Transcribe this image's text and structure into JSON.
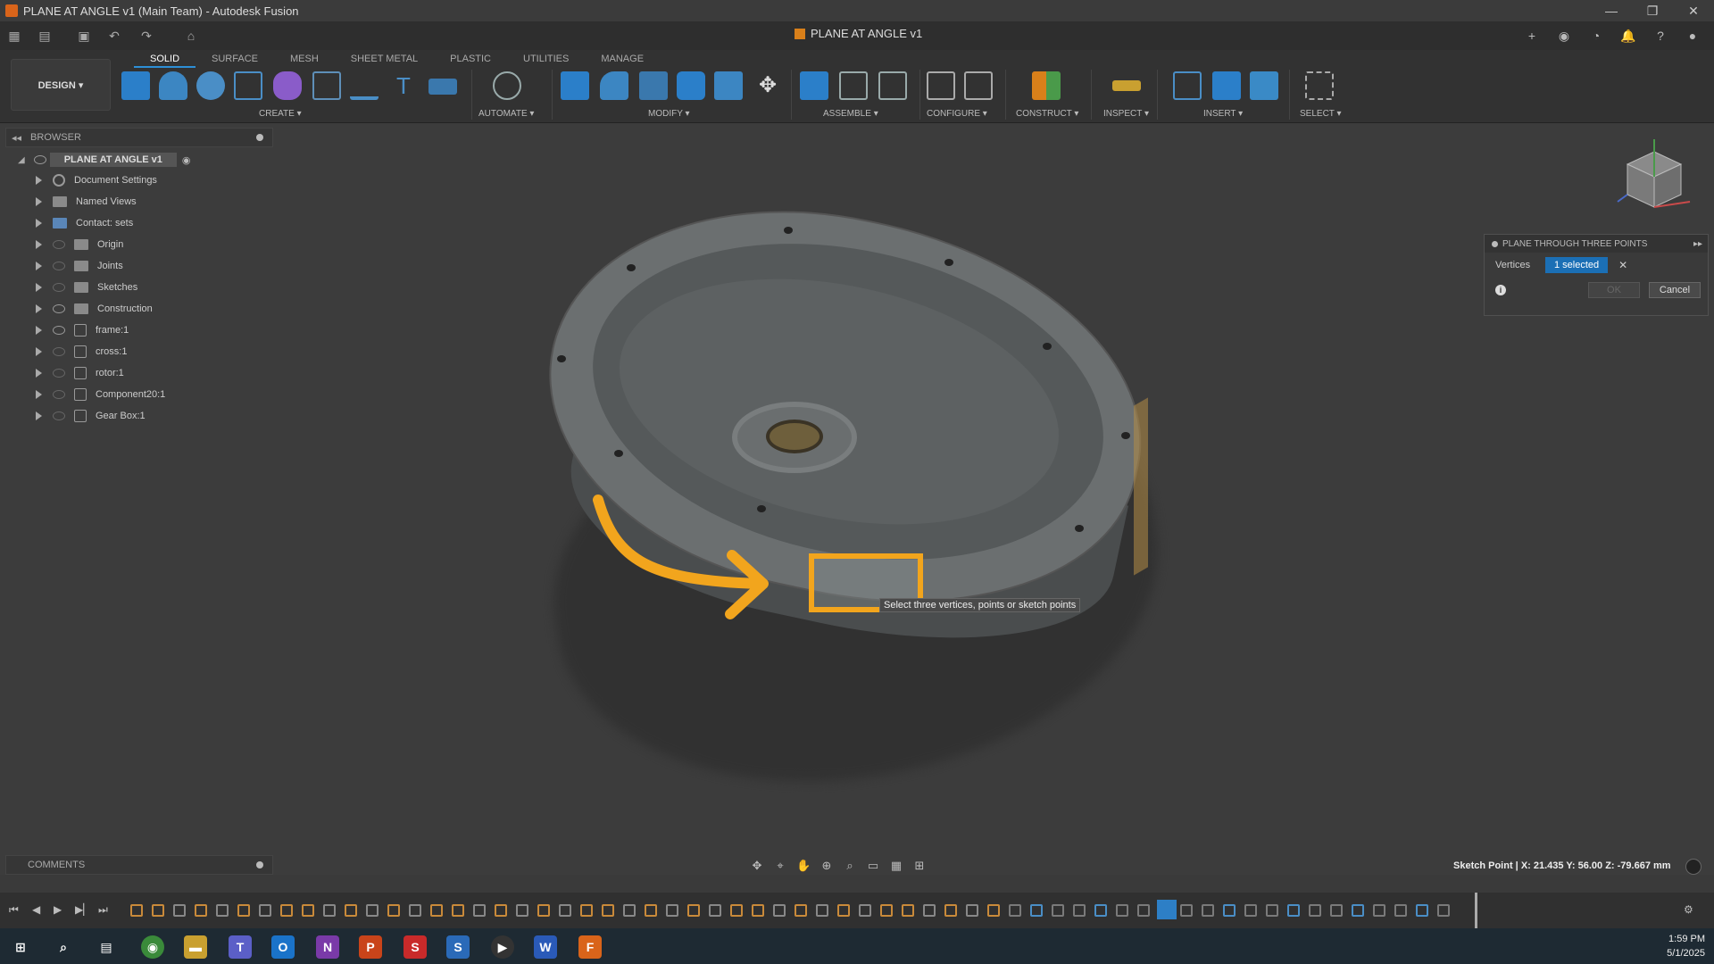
{
  "window": {
    "title": "PLANE AT ANGLE v1 (Main Team) - Autodesk Fusion",
    "controls": [
      "—",
      "❐",
      "✕"
    ]
  },
  "document_tab": {
    "title": "PLANE AT ANGLE v1"
  },
  "workspace": {
    "design_label": "DESIGN ▾"
  },
  "ribbon_tabs": [
    {
      "label": "SOLID",
      "active": true
    },
    {
      "label": "SURFACE"
    },
    {
      "label": "MESH"
    },
    {
      "label": "SHEET METAL"
    },
    {
      "label": "PLASTIC"
    },
    {
      "label": "UTILITIES"
    },
    {
      "label": "MANAGE"
    }
  ],
  "ribbon_groups": {
    "create": "CREATE ▾",
    "automate": "AUTOMATE ▾",
    "modify": "MODIFY ▾",
    "assemble": "ASSEMBLE ▾",
    "configure": "CONFIGURE ▾",
    "construct": "CONSTRUCT ▾",
    "inspect": "INSPECT ▾",
    "insert": "INSERT ▾",
    "select": "SELECT ▾"
  },
  "browser": {
    "header": "BROWSER",
    "root": "PLANE AT ANGLE v1",
    "items": [
      {
        "label": "Document Settings"
      },
      {
        "label": "Named Views"
      },
      {
        "label": "Contact: sets"
      },
      {
        "label": "Origin"
      },
      {
        "label": "Joints"
      },
      {
        "label": "Sketches"
      },
      {
        "label": "Construction"
      },
      {
        "label": "frame:1"
      },
      {
        "label": "cross:1"
      },
      {
        "label": "rotor:1"
      },
      {
        "label": "Component20:1"
      },
      {
        "label": "Gear Box:1"
      }
    ]
  },
  "command_dialog": {
    "title": "PLANE THROUGH THREE POINTS",
    "vertices_label": "Vertices",
    "selection": "1 selected",
    "ok_label": "OK",
    "cancel_label": "Cancel"
  },
  "tooltip": "Select three vertices, points or sketch points",
  "comments": {
    "header": "COMMENTS"
  },
  "status": {
    "coordinates": "Sketch Point | X: 21.435 Y: 56.00 Z: -79.667 mm"
  },
  "taskbar": {
    "time": "1:59 PM",
    "date": "5/1/2025"
  },
  "colors": {
    "accent": "#2d8fd6",
    "highlight": "#f2a51d",
    "selection": "#1b6fb5",
    "fusion": "#d9641a"
  }
}
